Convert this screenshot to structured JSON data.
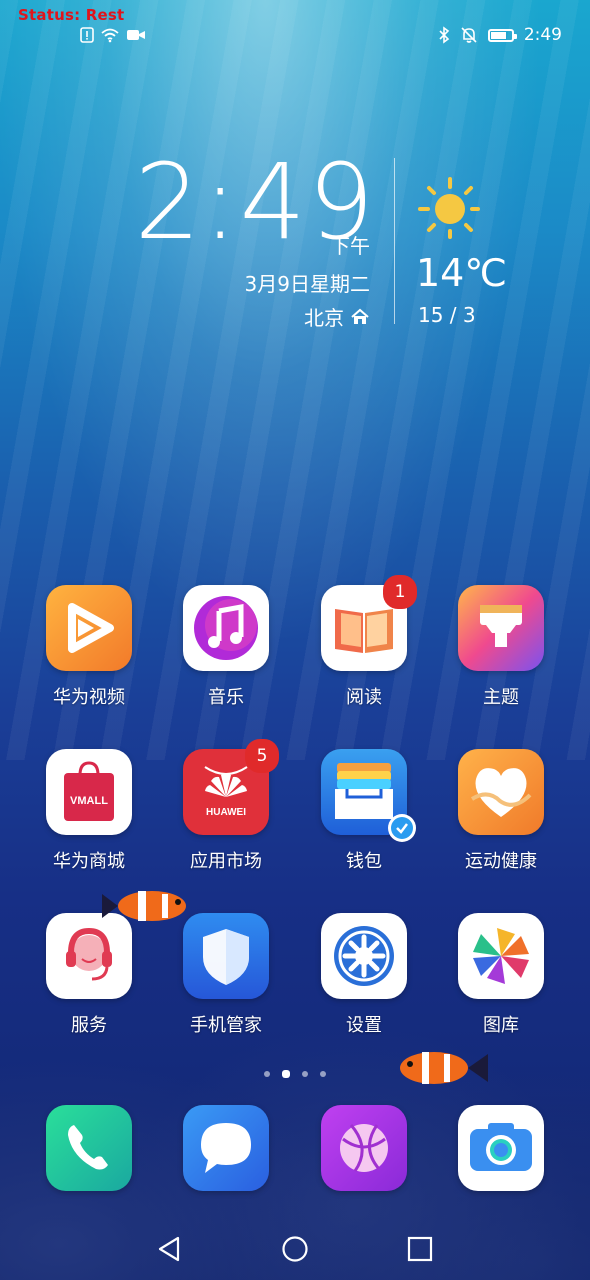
{
  "status_bar": {
    "overlay_label": "Status: Rest",
    "time": "2:49",
    "left_icons": [
      "alert-icon",
      "wifi-icon",
      "video-icon"
    ],
    "right_icons": [
      "bluetooth-icon",
      "mute-icon",
      "battery-icon"
    ]
  },
  "clock_widget": {
    "time": "2:49",
    "ampm": "下午",
    "date": "3月9日星期二",
    "city": "北京",
    "city_icon": "home-icon"
  },
  "weather_widget": {
    "icon": "sun-icon",
    "temperature": "14℃",
    "range": "15 / 3"
  },
  "apps": [
    {
      "label": "华为视频",
      "icon": "video-play-icon",
      "color": "#f7a133"
    },
    {
      "label": "音乐",
      "icon": "music-note-icon",
      "color": "#ffffff"
    },
    {
      "label": "阅读",
      "icon": "book-icon",
      "color": "#ffffff",
      "badge": "1"
    },
    {
      "label": "主题",
      "icon": "paint-brush-icon",
      "color": "#e040a0"
    },
    {
      "label": "华为商城",
      "icon": "vmall-bag-icon",
      "color": "#ffffff",
      "text": "VMALL"
    },
    {
      "label": "应用市场",
      "icon": "huawei-logo-icon",
      "color": "#e0303a",
      "text": "HUAWEI",
      "badge": "5"
    },
    {
      "label": "钱包",
      "icon": "wallet-icon",
      "color": "#2a6fe0"
    },
    {
      "label": "运动健康",
      "icon": "heart-icon",
      "color": "#f28a2e"
    },
    {
      "label": "服务",
      "icon": "headset-icon",
      "color": "#ffffff"
    },
    {
      "label": "手机管家",
      "icon": "shield-icon",
      "color": "#2f6fe8"
    },
    {
      "label": "设置",
      "icon": "gear-icon",
      "color": "#ffffff"
    },
    {
      "label": "图库",
      "icon": "pinwheel-icon",
      "color": "#ffffff"
    }
  ],
  "dock": [
    {
      "name": "phone",
      "icon": "phone-icon",
      "color": "#25c28a"
    },
    {
      "name": "messages",
      "icon": "chat-bubble-icon",
      "color": "#2f7fe8"
    },
    {
      "name": "browser",
      "icon": "globe-icon",
      "color": "#b02ee0"
    },
    {
      "name": "camera",
      "icon": "camera-icon",
      "color": "#ffffff"
    }
  ],
  "page_indicator": {
    "pages": 4,
    "active": 1
  },
  "nav_bar": [
    "back-icon",
    "home-icon",
    "recents-icon"
  ]
}
